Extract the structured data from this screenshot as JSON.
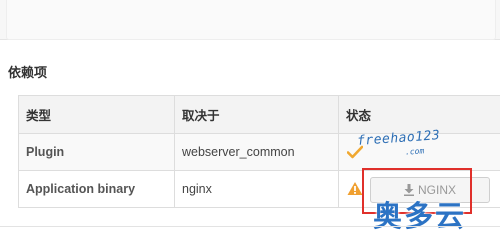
{
  "section": {
    "title": "依赖项"
  },
  "table": {
    "headers": [
      "类型",
      "取决于",
      "状态"
    ],
    "rows": [
      {
        "type": "Plugin",
        "depends_on": "webserver_common",
        "status": "ok"
      },
      {
        "type": "Application binary",
        "depends_on": "nginx",
        "status": "missing",
        "action_label": "NGINX"
      }
    ]
  },
  "icons": {
    "ok": "check-icon",
    "missing": "warning-icon",
    "action": "download-icon"
  },
  "colors": {
    "ok": "#f0a830",
    "warning": "#f0a030",
    "highlight": "#e0302b",
    "watermark": "#2e6fb5"
  },
  "watermarks": {
    "top": "freehao123",
    "top_suffix": ".com",
    "bottom": "奥多云"
  }
}
